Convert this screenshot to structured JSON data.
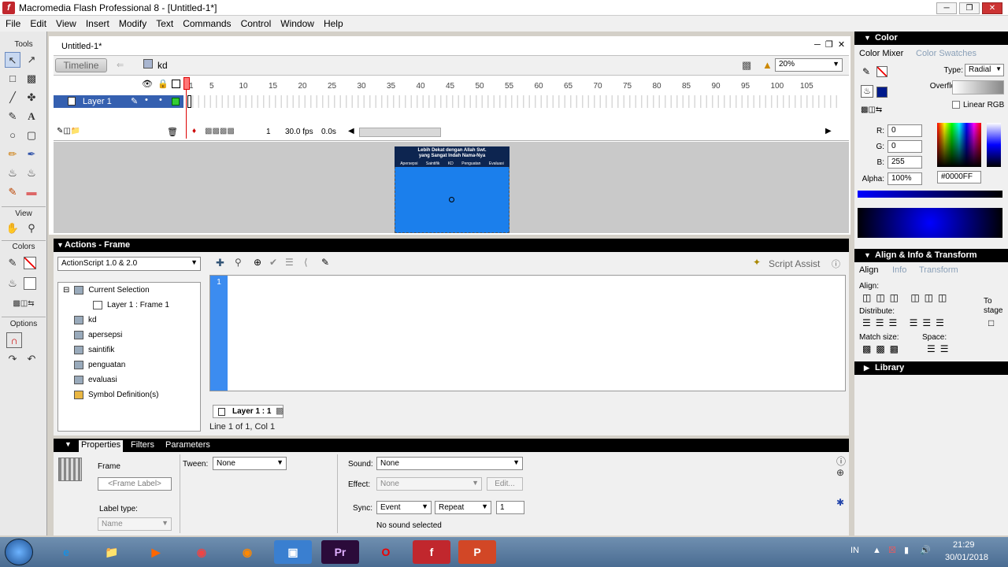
{
  "window": {
    "title": "Macromedia Flash Professional 8 - [Untitled-1*]"
  },
  "menu": [
    "File",
    "Edit",
    "View",
    "Insert",
    "Modify",
    "Text",
    "Commands",
    "Control",
    "Window",
    "Help"
  ],
  "tools": {
    "header": "Tools",
    "view_label": "View",
    "colors_label": "Colors",
    "options_label": "Options"
  },
  "document": {
    "tab": "Untitled-1*",
    "timeline_button": "Timeline",
    "scene": "kd",
    "zoom": "20%"
  },
  "timeline": {
    "layer_name": "Layer 1",
    "frame_numbers": [
      "1",
      "5",
      "10",
      "15",
      "20",
      "25",
      "30",
      "35",
      "40",
      "45",
      "50",
      "55",
      "60",
      "65",
      "70",
      "75",
      "80",
      "85",
      "90",
      "95",
      "100",
      "105"
    ],
    "current_frame": "1",
    "fps": "30.0 fps",
    "time": "0.0s"
  },
  "stage": {
    "header_line1": "Lebih Dekat dengan Allah Swt.",
    "header_line2": "yang Sangat Indah Nama-Nya",
    "nav": [
      "Apersepsi",
      "Saintifik",
      "KD",
      "Penguatan",
      "Evaluasi"
    ]
  },
  "actions": {
    "title": "Actions - Frame",
    "language": "ActionScript 1.0 & 2.0",
    "script_assist": "Script Assist",
    "tree": {
      "current_selection": "Current Selection",
      "layer_frame": "Layer 1 : Frame 1",
      "items": [
        "kd",
        "apersepsi",
        "saintifik",
        "penguatan",
        "evaluasi"
      ],
      "symbols": "Symbol Definition(s)"
    },
    "line_number": "1",
    "tab": "Layer 1 : 1",
    "status": "Line 1 of 1, Col 1"
  },
  "properties": {
    "tabs": [
      "Properties",
      "Filters",
      "Parameters"
    ],
    "frame_label": "Frame",
    "frame_label_placeholder": "<Frame Label>",
    "label_type": "Label type:",
    "label_type_value": "Name",
    "tween_label": "Tween:",
    "tween_value": "None",
    "sound_label": "Sound:",
    "sound_value": "None",
    "effect_label": "Effect:",
    "effect_value": "None",
    "edit_button": "Edit...",
    "sync_label": "Sync:",
    "sync_value": "Event",
    "repeat_value": "Repeat",
    "repeat_count": "1",
    "sound_status": "No sound selected"
  },
  "color_panel": {
    "title": "Color",
    "tabs": [
      "Color Mixer",
      "Color Swatches"
    ],
    "type_label": "Type:",
    "type_value": "Radial",
    "overflow_label": "Overflow:",
    "linear_rgb": "Linear RGB",
    "r_label": "R:",
    "r_value": "0",
    "g_label": "G:",
    "g_value": "0",
    "b_label": "B:",
    "b_value": "255",
    "alpha_label": "Alpha:",
    "alpha_value": "100%",
    "hex_value": "#0000FF",
    "fill_color": "#0000FF"
  },
  "align_panel": {
    "title": "Align & Info & Transform",
    "tabs": [
      "Align",
      "Info",
      "Transform"
    ],
    "align_label": "Align:",
    "distribute_label": "Distribute:",
    "match_label": "Match size:",
    "space_label": "Space:",
    "to_stage_line1": "To",
    "to_stage_line2": "stage"
  },
  "library_panel": {
    "title": "Library"
  },
  "taskbar": {
    "lang": "IN",
    "time": "21:29",
    "date": "30/01/2018"
  }
}
